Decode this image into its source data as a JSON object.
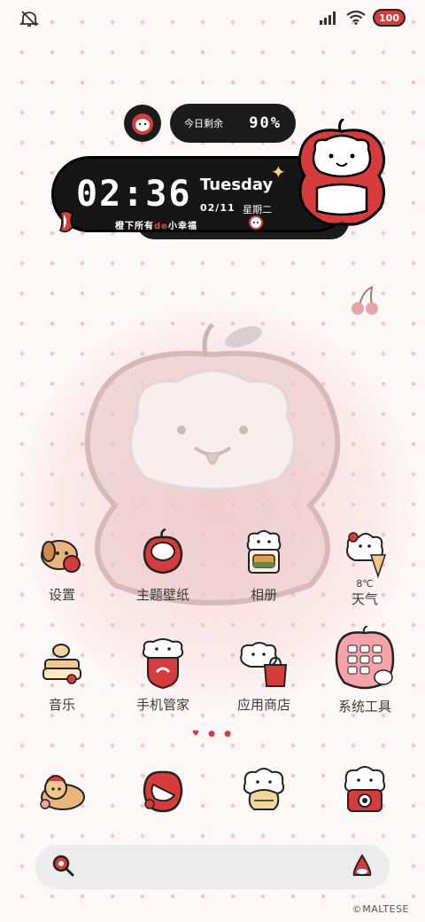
{
  "status_bar": {
    "battery_level": "100",
    "icons": [
      "mute-icon",
      "signal-icon",
      "wifi-icon",
      "battery-icon"
    ]
  },
  "widgets": {
    "battery": {
      "label": "今日剩余",
      "value": "90%"
    },
    "clock": {
      "time": "02:36",
      "day": "Tuesday",
      "date": "02/11",
      "weekday": "星期二",
      "caption_prefix": "橙下所有",
      "caption_accent": "de",
      "caption_suffix": "小幸福"
    }
  },
  "apps": [
    {
      "label": "设置",
      "icon": "dog-with-apple-icon"
    },
    {
      "label": "主题壁纸",
      "icon": "apple-icon"
    },
    {
      "label": "相册",
      "icon": "puppy-photo-icon"
    },
    {
      "label": "天气",
      "icon": "puppy-weather-icon",
      "temp": "8℃"
    },
    {
      "label": "音乐",
      "icon": "cake-music-icon"
    },
    {
      "label": "手机管家",
      "icon": "puppy-shield-icon"
    },
    {
      "label": "应用商店",
      "icon": "puppy-app-bag-icon"
    },
    {
      "label": "系统工具",
      "icon": "folder-icon"
    }
  ],
  "page_indicator": {
    "count": 3,
    "active": 0
  },
  "dock": [
    {
      "icon": "dog-lying-icon"
    },
    {
      "icon": "apple-bite-icon"
    },
    {
      "icon": "puppy-burger-icon"
    },
    {
      "icon": "puppy-camera-icon"
    }
  ],
  "search": {
    "left_icon": "search-icon",
    "right_icon": "assistant-icon"
  },
  "watermark": "©MALTESE",
  "colors": {
    "accent_red": "#d83b3b",
    "dark": "#1b1b1b",
    "background": "#fdf8f8",
    "dot": "#f1c7c9"
  }
}
